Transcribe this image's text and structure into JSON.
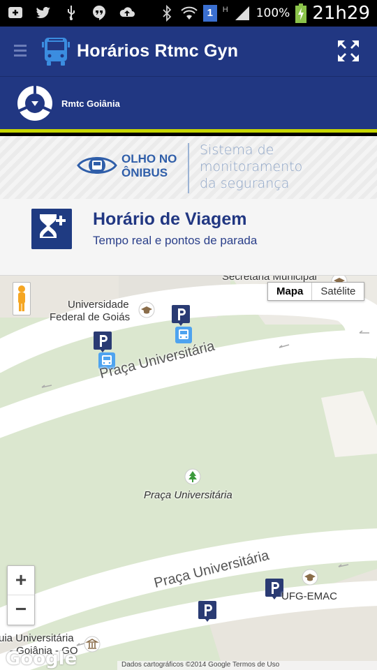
{
  "status_bar": {
    "battery_percent": "100%",
    "time": "21h29",
    "notification_badge": "1",
    "network_type": "H"
  },
  "app_bar": {
    "title": "Horários Rtmc Gyn"
  },
  "operator_bar": {
    "name": "Rmtc Goiânia"
  },
  "banner": {
    "brand_line1": "OLHO NO",
    "brand_line2": "ÔNIBUS",
    "tagline_line1": "Sistema de",
    "tagline_line2": "monitoramento",
    "tagline_line3": "da segurança"
  },
  "info": {
    "heading": "Horário de Viagem",
    "subheading": "Tempo real e pontos de parada"
  },
  "map": {
    "type_options": [
      "Mapa",
      "Satélite"
    ],
    "selected_type": "Mapa",
    "zoom_in": "+",
    "zoom_out": "−",
    "labels": {
      "secretaria": "Secretaria Municipal",
      "ufg_line1": "Universidade",
      "ufg_line2": "Federal de Goiás",
      "road_top": "Praça Universitária",
      "park": "Praça Universitária",
      "road_bottom": "Praça Universitária",
      "ufg_emac": "UFG-EMAC",
      "bottom_left_line1": "uia Universitária",
      "bottom_left_line2": "- Goiânia - GO"
    },
    "google_logo": "Google",
    "attribution": "Dados cartográficos ©2014 Google    Termos de Uso"
  }
}
